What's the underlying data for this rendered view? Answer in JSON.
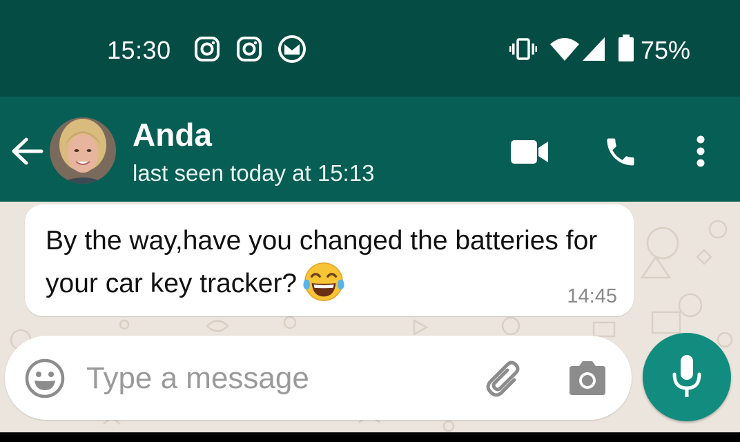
{
  "status_bar": {
    "time": "15:30",
    "notification_icons": [
      "instagram-icon",
      "instagram-icon",
      "mail-icon"
    ],
    "system_icons": [
      "vibrate-icon",
      "wifi-icon",
      "signal-icon",
      "battery-icon"
    ],
    "battery": "75%"
  },
  "header": {
    "back_icon": "arrow-left-icon",
    "contact_name": "Anda",
    "last_seen": "last seen today at 15:13",
    "actions": [
      "video-call-icon",
      "phone-icon",
      "more-vert-icon"
    ]
  },
  "messages": [
    {
      "text": "By the way,have you changed the batteries for your car key tracker?",
      "emoji": "😂",
      "time": "14:45",
      "direction": "incoming"
    }
  ],
  "composer": {
    "placeholder": "Type a message",
    "value": "",
    "icons": [
      "emoji-icon",
      "attachment-icon",
      "camera-icon"
    ],
    "send_icon": "mic-icon"
  },
  "colors": {
    "status_bar": "#054d44",
    "header": "#075e54",
    "chat_bg": "#ece5dd",
    "bubble": "#ffffff",
    "fab": "#128c7e"
  }
}
